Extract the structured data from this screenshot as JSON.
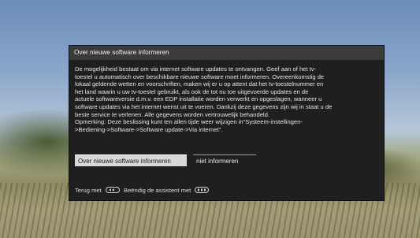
{
  "dialog": {
    "title": "Over nieuwe software informeren",
    "body_lines": [
      "De mogelijkheid bestaat om via internet software updates te ontvangen. Geef aan of het tv-",
      "toestel u automatisch over beschikbare nieuwe software moet informeren. Overeenkomstig de",
      "lokaal geldende wetten en voorschriften, maken wij er u op attent dat het tv-toestelnummer en",
      "het land waarin u uw tv-toestel gebruikt, als ook de tot nu toe uitgevoerde updates en de",
      "actuele softwareversie d.m.v. een EDP installatie worden verwerkt en opgeslagen, wanneer u",
      "software updates via het internet wenst uit te voeren. Dankzij deze gegevens zijn wij in staat u  de",
      "beste service te verlenen. Alle gegevens worden vertrouwelijk behandeld.",
      "Opmerking: Deze beslissing kunt ten allen tijde weer wijzigen in\"Systeem-instellingen-",
      ">Bediening->Software->Software update->Via internet\"."
    ],
    "buttons": {
      "inform": "Over nieuwe software informeren",
      "dont_inform": "niet informeren"
    },
    "footer": {
      "back_label": "Terug met",
      "back_key_icon": "back-key-icon",
      "exit_label": "Beëndig de assistent met",
      "exit_key_icon": "end-key-icon"
    }
  },
  "colors": {
    "panel_bg": "#1f1f1f",
    "title_bar_bg": "#3b3b3b",
    "selected_button_bg": "#d8d8d8"
  }
}
